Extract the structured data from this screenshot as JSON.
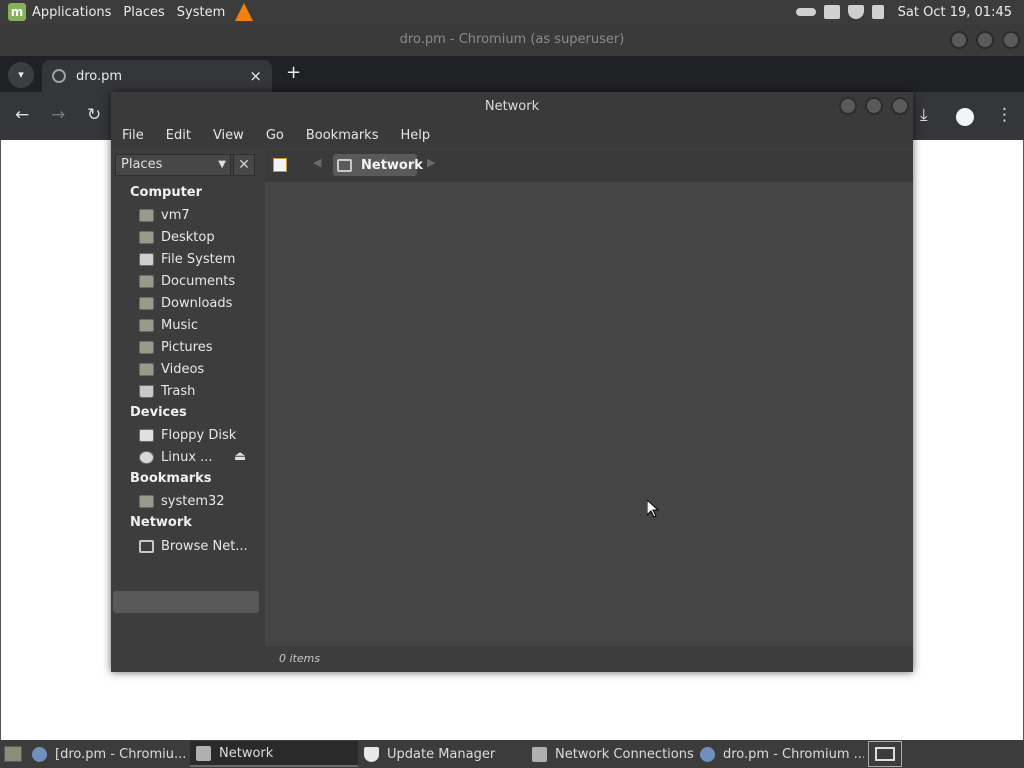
{
  "top_panel": {
    "applications": "Applications",
    "places": "Places",
    "system": "System",
    "clock": "Sat Oct 19, 01:45"
  },
  "chromium": {
    "title": "dro.pm - Chromium (as superuser)",
    "tab_title": "dro.pm",
    "tab_close": "×",
    "new_tab": "+"
  },
  "nemo": {
    "title": "Network",
    "menu": [
      "File",
      "Edit",
      "View",
      "Go",
      "Bookmarks",
      "Help"
    ],
    "places_label": "Places",
    "places_close": "✕",
    "breadcrumb": "Network",
    "status": "0 items",
    "sidebar": {
      "computer_heading": "Computer",
      "computer_items": [
        "vm7",
        "Desktop",
        "File System",
        "Documents",
        "Downloads",
        "Music",
        "Pictures",
        "Videos",
        "Trash"
      ],
      "devices_heading": "Devices",
      "devices_items": [
        "Floppy Disk",
        "Linux ..."
      ],
      "bookmarks_heading": "Bookmarks",
      "bookmarks_items": [
        "system32"
      ],
      "network_heading": "Network",
      "network_items": [
        "Browse Net..."
      ]
    }
  },
  "taskbar": {
    "items": [
      "[dro.pm - Chromiu...",
      "Network",
      "Update Manager",
      "Network Connections",
      "dro.pm - Chromium ..."
    ]
  },
  "colors": {
    "panel_bg": "#3c3c3c",
    "window_bg": "#3d3d3d",
    "view_bg": "#454545",
    "mint_green": "#87b158"
  }
}
